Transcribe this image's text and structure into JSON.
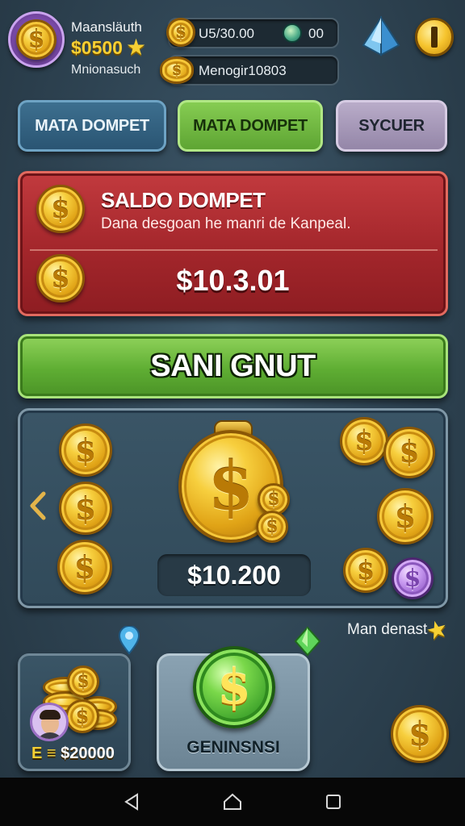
{
  "player": {
    "name": "Maansläuth",
    "gold": "$0500",
    "subtitle": "Mnionasuch"
  },
  "hud": {
    "coins_value": "U5/30.00",
    "gems_value": "00",
    "message_value": "Menogir10803"
  },
  "tabs": [
    {
      "label": "MATA DOMPET",
      "color": "#2f5a76"
    },
    {
      "label": "MATA DOMPET",
      "color": "#6fbd3e"
    },
    {
      "label": "SYCUER",
      "color": "#a89ab8"
    }
  ],
  "wallet_panel": {
    "title": "SALDO DOMPET",
    "description": "Dana desgoan he manri de Kanpeal.",
    "balance": "$10.3.01"
  },
  "action_button": {
    "label": "SANI GNUT"
  },
  "coin_board": {
    "total": "$10.200",
    "coin_symbol": "$"
  },
  "side_note": {
    "label": "Man denast"
  },
  "bottom_cards": {
    "stack_value_prefix": "E ≡",
    "stack_value": "$20000",
    "center_label": "GENINSNSI"
  },
  "icons": {
    "back": "chevron-left-icon",
    "nav_back": "triangle-back-icon",
    "nav_home": "home-icon",
    "nav_recent": "square-recent-icon"
  },
  "colors": {
    "red_panel": "#a3262b",
    "green_button": "#5fae33",
    "gold": "#f7cf3e",
    "background": "#2e4352"
  }
}
